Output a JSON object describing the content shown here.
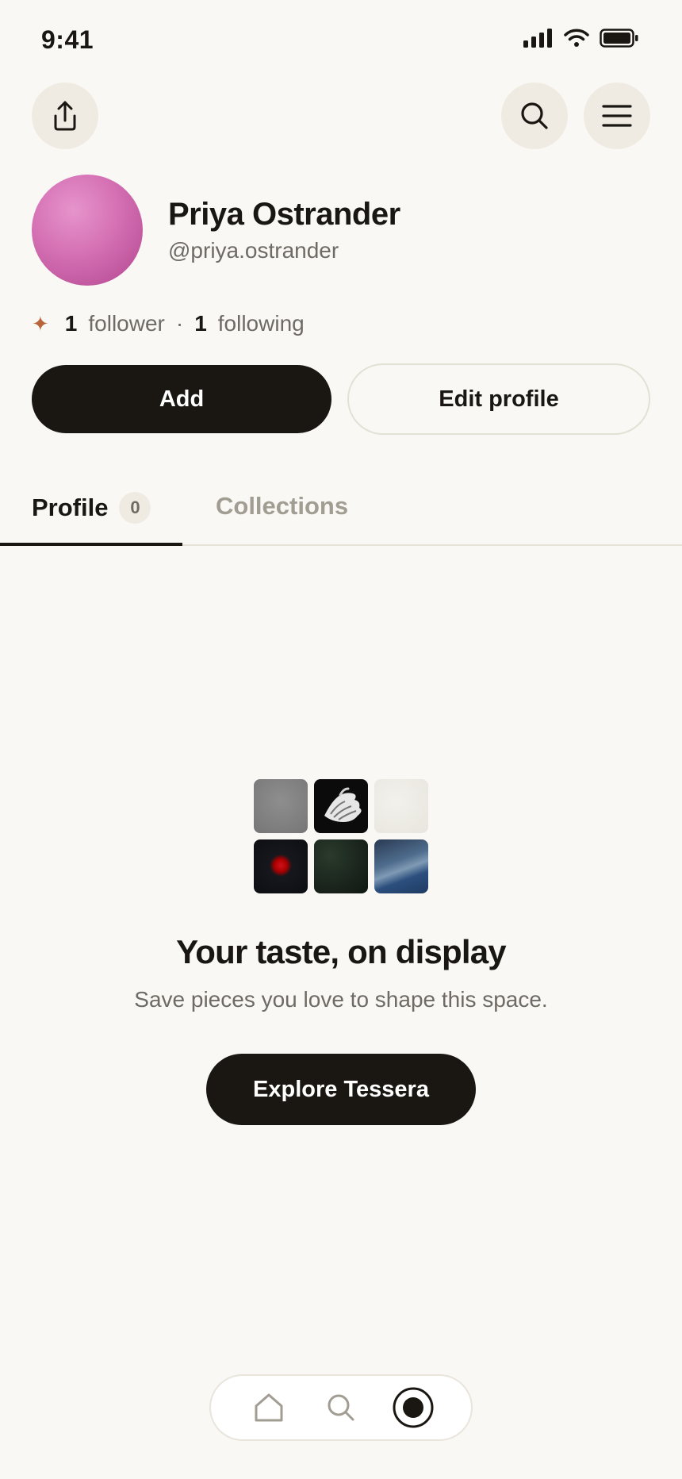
{
  "status_bar": {
    "time": "9:41"
  },
  "profile": {
    "display_name": "Priya Ostrander",
    "handle": "@priya.ostrander",
    "followers_count": "1",
    "followers_label": "follower",
    "separator": "·",
    "following_count": "1",
    "following_label": "following"
  },
  "actions": {
    "add_label": "Add",
    "edit_label": "Edit profile"
  },
  "tabs": [
    {
      "label": "Profile",
      "badge": "0",
      "active": true
    },
    {
      "label": "Collections",
      "active": false
    }
  ],
  "empty_state": {
    "title": "Your taste, on display",
    "subtitle": "Save pieces you love to shape this space.",
    "button_label": "Explore Tessera"
  },
  "nav": {
    "items": [
      "home-icon",
      "search-icon",
      "profile-record-icon"
    ],
    "active": "profile-record-icon"
  },
  "colors": {
    "accent_spark": "#b8653c",
    "primary": "#1a1713",
    "background": "#f9f8f4"
  }
}
